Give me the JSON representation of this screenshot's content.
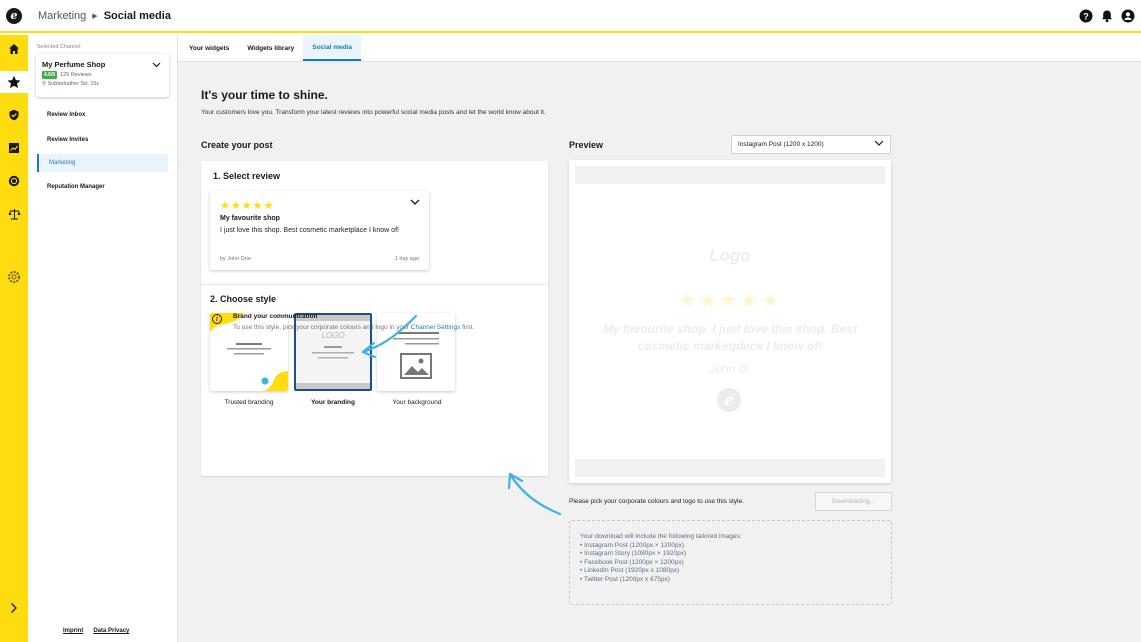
{
  "header": {
    "breadcrumb_parent": "Marketing",
    "breadcrumb_current": "Social media",
    "icons": [
      "help-icon",
      "bell-icon",
      "user-icon"
    ]
  },
  "rail": {
    "icons": [
      "home-icon",
      "star-icon",
      "shield-icon",
      "chart-icon",
      "coin-icon",
      "scales-icon",
      "settings-icon",
      "expand-chevron-icon"
    ],
    "active": "star-icon",
    "accent": "#ffdc0f"
  },
  "sidebar": {
    "channel_label": "Selected Channel",
    "channel_name": "My Perfume Shop",
    "rating_badge": "4.6/5",
    "reviews_count": "125 Reviews",
    "address": "Subbelrather Str. 15c",
    "nav": [
      {
        "label": "Review Inbox"
      },
      {
        "label": "Review Invites"
      },
      {
        "label": "Marketing"
      },
      {
        "label": "Reputation Manager"
      }
    ],
    "footer": {
      "imprint": "Imprint",
      "privacy": "Data Privacy"
    }
  },
  "tabs": [
    {
      "label": "Your widgets"
    },
    {
      "label": "Widgets library"
    },
    {
      "label": "Social media"
    }
  ],
  "main": {
    "headline": "It's your time to shine.",
    "subline": "Your customers love you. Transform your latest reviews into powerful social media posts and let the world know about it.",
    "create_title": "Create your post",
    "step1": "1. Select review",
    "review": {
      "stars": "★★★★★",
      "title": "My favourite shop",
      "body": "I just love this shop. Best cosmetic marketplace I know of!",
      "author": "by John Doe",
      "time": "1 day ago"
    },
    "step2": "2. Choose style",
    "styles": [
      {
        "label": "Trusted branding"
      },
      {
        "label": "Your branding",
        "logo_text": "LOGO"
      },
      {
        "label": "Your background"
      }
    ],
    "info": {
      "title": "Brand your communication",
      "body": "To use this style, pick your corporate colours and logo in your",
      "link": "Channel Settings",
      "tail": "first."
    }
  },
  "preview": {
    "title": "Preview",
    "format_selected": "Instagram Post (1200 x 1200)",
    "logo": "Logo",
    "stars": "★★★★★",
    "text": "My favourite shop. I just love this shop. Best cosmetic marketplace I know of!",
    "author": "John D.",
    "pick_text": "Please pick your corporate colours and logo to use this style.",
    "download_button": "Downloading...",
    "download_info_title": "Your download will include the following tailored images:",
    "download_items": [
      "• Instagram Post (1200px × 1200px)",
      "• Instagram Story (1080px × 1920px)",
      "• Facebook Post (1200px × 1200px)",
      "• LinkedIn Post (1920px x 1080px)",
      "• Twitter Post (1200px x 675px)"
    ]
  },
  "colors": {
    "accent_yellow": "#ffdc0f",
    "link_blue": "#1b7bb8",
    "annotation_blue": "#3db3e6",
    "selected_border": "#1c4e8a",
    "rating_green": "#3fae49"
  }
}
